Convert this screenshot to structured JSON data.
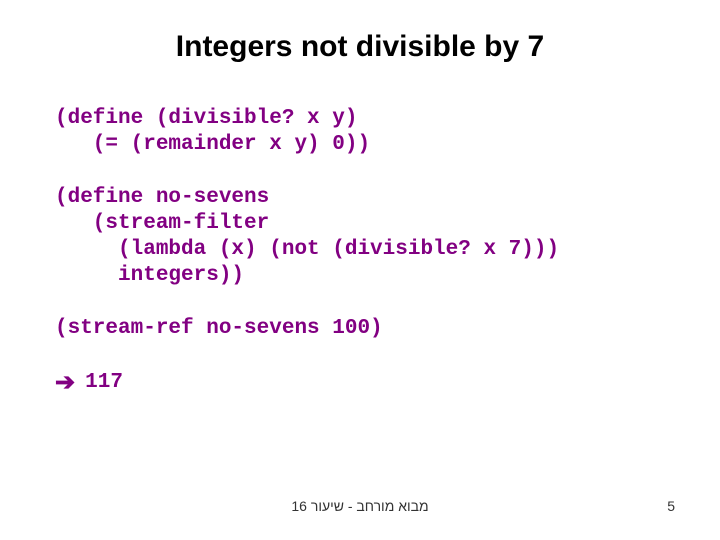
{
  "title": "Integers not divisible by 7",
  "code1": "(define (divisible? x y)\n   (= (remainder x y) 0))",
  "code2": "(define no-sevens\n   (stream-filter\n     (lambda (x) (not (divisible? x 7)))\n     integers))",
  "code3": "(stream-ref no-sevens 100)",
  "arrow": "➔",
  "result": "117",
  "footer_center": "מבוא מורחב - שיעור 16",
  "footer_page": "5"
}
